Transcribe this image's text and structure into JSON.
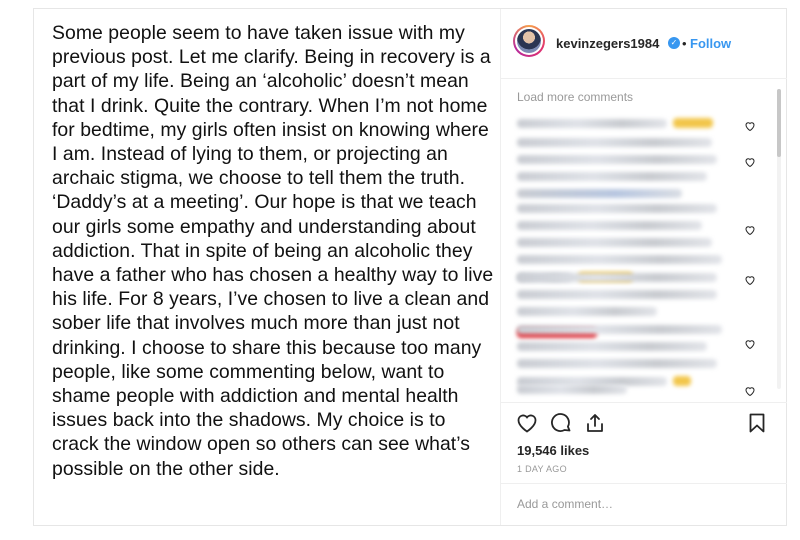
{
  "post": {
    "text": "Some people seem to have taken issue with my previous post. Let me clarify. Being in recovery is a part of my life. Being an ‘alcoholic’ doesn’t mean that I drink. Quite the contrary. When I’m not home for bedtime, my girls often insist on knowing where I am. Instead of lying to them, or projecting an archaic stigma, we choose to tell them the truth. ‘Daddy’s at a meeting’. Our hope is that we teach our girls some empathy and understanding about addiction. That in spite of being an alcoholic they have a father who has chosen a healthy way to live his life. For 8 years, I’ve chosen to live a clean and sober life that involves much more than just not drinking. I choose to share this because too many people, like some commenting below, want to shame people with addiction and mental health issues back into the shadows. My choice is to crack the window open so others can see what’s possible on the other side."
  },
  "header": {
    "username": "kevinzegers1984",
    "verified_glyph": "✓",
    "separator": "•",
    "follow_label": "Follow"
  },
  "comments": {
    "load_more_label": "Load more comments",
    "heart_icon": "heart-outline-icon"
  },
  "actions": {
    "likes": "19,546 likes",
    "time": "1 DAY AGO"
  },
  "add_comment": {
    "placeholder": "Add a comment…"
  },
  "colors": {
    "link_blue": "#3897f0",
    "text_dark": "#262626",
    "muted": "#999999"
  }
}
